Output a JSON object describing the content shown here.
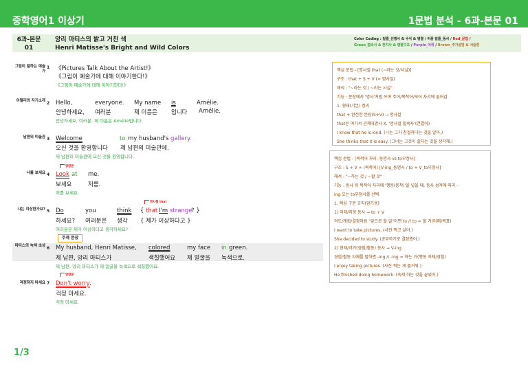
{
  "header": {
    "left_title": "중학영어1 이상기",
    "right_title": "1문법 분석 - 6과-본문 01"
  },
  "lesson": {
    "code": [
      "6과-본문",
      "01"
    ],
    "title_ko": "앙리 마티스의 밝고 거친 색",
    "title_en": "Henri Matisse's Bright and Wild Colors"
  },
  "legend": {
    "line1": {
      "prefix": "Color Coding : 밑줄_선행사 & 수식 & 병렬 / 이중 밑줄_동사 / ",
      "red": "Red_문법",
      "suffix": " /"
    },
    "line2": {
      "green": "Green_접속사 & 전치사 & 병렬구조",
      "sep1": " / ",
      "purple": "Purple_어휘",
      "sep2": " / ",
      "brown": "Brown_추가설명 & 서술형"
    }
  },
  "colors": {
    "brand_green": "#3cb84a",
    "red": "#e02020",
    "green": "#2ea12e",
    "purple": "#9a3fc6",
    "brown": "#b5702a",
    "box_border": "#f5b428"
  },
  "rows": [
    {
      "label": "그림이 말하는 예술가",
      "num": "1",
      "en": "《Pictures Talk About the Artist!》",
      "ko": "《그림이 예술가에 대해 이야기한다!》",
      "tr": "《그림이 예술가에 대해 이야기한다!》"
    },
    {
      "label": "아멜리의 자기소개",
      "num": "2",
      "en": [
        "Hello,",
        "everyone.",
        "My name",
        "is",
        "Amélie."
      ],
      "ko": [
        "안녕하세요,",
        "여러분",
        "제 이름은",
        "입니다",
        "Amélie."
      ],
      "tr": "안녕하세요, 여러분. 제 이름은 Amélie입니다."
    },
    {
      "label": "남편의 미술관",
      "num": "3",
      "en": {
        "w1": "Welcome",
        "w2": "to",
        "w3": "my husband's",
        "w4": "gallery",
        "w5": "."
      },
      "ko": [
        "오신 것을 환영합니다",
        "제 남편의 미술관에."
      ],
      "tr": "제 남편의 미술관에 오신 것을 환영합니다."
    },
    {
      "label": "나를 보세요",
      "num": "4",
      "tag": "명령문",
      "en": {
        "w1": "Look",
        "w2": "at",
        "w3": "me."
      },
      "ko": [
        "보세요",
        "저를."
      ],
      "tr": "저를 보세요."
    },
    {
      "label": "나는 이상한가요?",
      "num": "5",
      "tag": "명사절 that",
      "en": {
        "w1": "Do",
        "w2": "you",
        "w3": "think",
        "w4": "{",
        "w5": "that",
        "w6": "I'm",
        "w7": "strange",
        "w8": "? }"
      },
      "ko": [
        "하세요?",
        "여러분은",
        "생각",
        "{ 제가 이상하다고 }"
      ],
      "tr": "여러분은 제가 이상하다고 생각하세요?"
    },
    {
      "label": "마티스의 녹색 초상",
      "num": "6",
      "tag": "주제 문장",
      "en": {
        "w1": "My husband, Henri Matisse,",
        "w2": "colored",
        "w3": "my face",
        "w4": "in",
        "w5": "green."
      },
      "ko": [
        "제 남편, 앙리 마티스가",
        "색칠했어요",
        "제 얼굴을",
        "녹색으로."
      ],
      "tr": "제 남편, 앙리 마티스가 제 얼굴을 녹색으로 색칠했어요."
    },
    {
      "label": "걱정하지 마세요",
      "num": "7",
      "tag": "명령문",
      "en": {
        "w1": "Don't worry",
        "w2": "."
      },
      "ko": [
        "걱정 마세요."
      ],
      "tr": "걱정 마세요."
    }
  ],
  "box1": {
    "lines": [
      "핵심 문법 - [명사절 that (~라는 것/사실)]",
      "구조 : that + S + V (= 명사절)",
      "해석 : \"~라는 것 / ~라는 사실\"",
      "기능 : 문장에서 '명사'처럼 쓰여 주어/목적어/보어 자리에 들어감",
      "1. 형태(기본) 정리",
      "that + 완전한 문장(S+V) → 명사절",
      "that은 여기서 관계대명사 X, '명사절 접속사'(연결어)",
      "I know that he is kind. (나는 그가 친절하다는 것을 알아.)",
      "She thinks that it is easy. (그녀는 그것이 쉽다는 것을 생각해.)"
    ]
  },
  "box2": {
    "lines": [
      "핵심 문법 - [목적어 자리: 동명사 vs to부정사]",
      "구조 : S + V + (목적어) [V-ing_동명사 / to + V_to부정사]",
      "해석 : \"~하는 것 / ~할 것\"",
      "기능 : 동사 뒤 목적어 자리에 '행동(동작)'을 넣을 때, 동사 성격에 따라 -",
      "ing 또는 to부정사를 선택",
      "1. 핵심 구분 규칙(암기용)",
      "1) 미래/지향 동사 → to + V",
      "의도/계획/결정처럼 \"앞으로 할 일\"이면 to // to = 할 거(미래/목표)",
      "I want to take pictures. (사진 찍고 싶어.)",
      "She decided to study. (공부하기로 결정했어.)",
      "2) 현재/과거(경험/활동) 동사 → V-ing",
      "경험/활동 자체를 말하면 -ing // -ing = 하는 거(행동 자체/경험)",
      "I enjoy taking pictures. (사진 찍는 게 즐거워.)",
      "He finished doing homework. (숙제 하는 것을 끝냈어.)"
    ]
  },
  "pager": "1/3"
}
